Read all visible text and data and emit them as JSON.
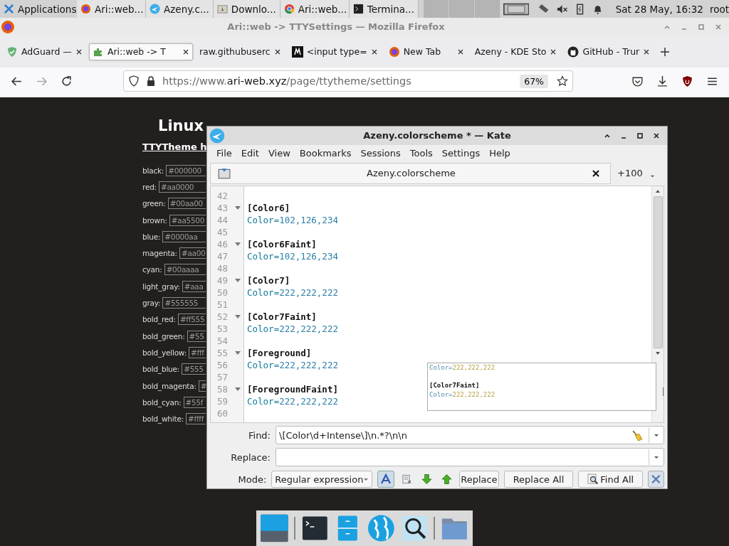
{
  "taskbar": {
    "menu_label": "Applications",
    "tasks": [
      {
        "label": "Ari::web...",
        "kind": "firefox"
      },
      {
        "label": "Azeny.c...",
        "kind": "kate"
      },
      {
        "label": "Downlo...",
        "kind": "download"
      },
      {
        "label": "Ari::web...",
        "kind": "chrome"
      },
      {
        "label": "Termina...",
        "kind": "terminal"
      }
    ],
    "clock": "Sat 28 May, 16:32",
    "user": "root"
  },
  "browser": {
    "title": "Ari::web -> TTYSettings — Mozilla Firefox",
    "tabs": [
      {
        "label": "AdGuard —",
        "kind": "shield",
        "selected": false
      },
      {
        "label": "Ari::web -> T",
        "kind": "puzzle",
        "selected": true
      },
      {
        "label": "raw.githubuserc",
        "kind": "plain",
        "selected": false
      },
      {
        "label": "<input type=",
        "kind": "m",
        "selected": false
      },
      {
        "label": "New Tab",
        "kind": "firefox",
        "selected": false
      },
      {
        "label": "Azeny - KDE Sto",
        "kind": "plain",
        "selected": false
      },
      {
        "label": "GitHub - Trur",
        "kind": "github",
        "selected": false
      }
    ],
    "url": {
      "prefix": "https://www.",
      "domain": "ari-web.xyz",
      "path": "/page/ttytheme/settings"
    },
    "zoom": "67%"
  },
  "page": {
    "heading": "Linux",
    "subheading": "TTYTheme h",
    "colors": [
      {
        "label": "black:",
        "value": "#000000"
      },
      {
        "label": "red:",
        "value": "#aa0000"
      },
      {
        "label": "green:",
        "value": "#00aa00"
      },
      {
        "label": "brown:",
        "value": "#aa5500"
      },
      {
        "label": "blue:",
        "value": "#0000aa"
      },
      {
        "label": "magenta:",
        "value": "#aa00"
      },
      {
        "label": "cyan:",
        "value": "#00aaaa"
      },
      {
        "label": "light_gray:",
        "value": "#aaa"
      },
      {
        "label": "gray:",
        "value": "#555555"
      },
      {
        "label": "bold_red:",
        "value": "#ff555"
      },
      {
        "label": "bold_green:",
        "value": "#55"
      },
      {
        "label": "bold_yellow:",
        "value": "#fff"
      },
      {
        "label": "bold_blue:",
        "value": "#555"
      },
      {
        "label": "bold_magenta:",
        "value": "#"
      },
      {
        "label": "bold_cyan:",
        "value": "#55f"
      },
      {
        "label": "bold_white:",
        "value": "#ffff"
      }
    ]
  },
  "kate": {
    "title": "Azeny.colorscheme * — Kate",
    "menu": [
      "File",
      "Edit",
      "View",
      "Bookmarks",
      "Sessions",
      "Tools",
      "Settings",
      "Help"
    ],
    "tab": "Azeny.colorscheme",
    "more_tabs": "+100",
    "lines": [
      {
        "num": "42",
        "kind": "blank"
      },
      {
        "num": "43",
        "kind": "section",
        "text": "[Color6]"
      },
      {
        "num": "44",
        "kind": "key",
        "key": "Color=",
        "value": "102,126,234"
      },
      {
        "num": "45",
        "kind": "blank"
      },
      {
        "num": "46",
        "kind": "section",
        "text": "[Color6Faint]"
      },
      {
        "num": "47",
        "kind": "key",
        "key": "Color=",
        "value": "102,126,234"
      },
      {
        "num": "48",
        "kind": "blank"
      },
      {
        "num": "49",
        "kind": "section",
        "text": "[Color7]"
      },
      {
        "num": "50",
        "kind": "key",
        "key": "Color=",
        "value": "222,222,222"
      },
      {
        "num": "51",
        "kind": "blank"
      },
      {
        "num": "52",
        "kind": "section",
        "text": "[Color7Faint]"
      },
      {
        "num": "53",
        "kind": "key",
        "key": "Color=",
        "value": "222,222,222"
      },
      {
        "num": "54",
        "kind": "blank"
      },
      {
        "num": "55",
        "kind": "section",
        "text": "[Foreground]"
      },
      {
        "num": "56",
        "kind": "key",
        "key": "Color=",
        "value": "222,222,222"
      },
      {
        "num": "57",
        "kind": "blank"
      },
      {
        "num": "58",
        "kind": "section",
        "text": "[ForegroundFaint]"
      },
      {
        "num": "59",
        "kind": "key",
        "key": "Color=",
        "value": "222,222,222"
      },
      {
        "num": "60",
        "kind": "blank"
      }
    ],
    "preview": [
      {
        "kind": "key",
        "key": "Color=",
        "value": "222,222,222"
      },
      {
        "kind": "blank"
      },
      {
        "kind": "section",
        "text": "[Color7Faint]"
      },
      {
        "kind": "key",
        "key": "Color=",
        "value": "222,222,222"
      }
    ],
    "find": {
      "find_label": "Find:",
      "find_value": "\\[Color\\d+Intense\\]\\n.*?\\n\\n",
      "replace_label": "Replace:",
      "mode_label": "Mode:",
      "mode": "Regular expression",
      "match_case": true,
      "buttons": [
        "Replace",
        "Replace All",
        "Find All"
      ]
    }
  }
}
